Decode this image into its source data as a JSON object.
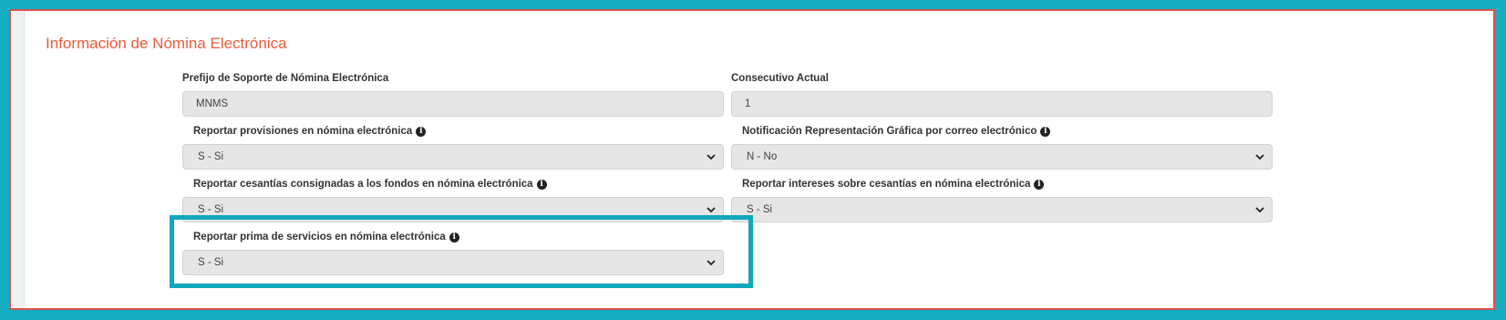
{
  "section": {
    "title": "Información de Nómina Electrónica"
  },
  "fields": {
    "prefijo": {
      "label": "Prefijo de Soporte de Nómina Electrónica",
      "value": "MNMS"
    },
    "consecutivo": {
      "label": "Consecutivo Actual",
      "value": "1"
    },
    "provisiones": {
      "label": "Reportar provisiones en nómina electrónica",
      "selected": "S - Si"
    },
    "notificacion": {
      "label": "Notificación Representación Gráfica por correo electrónico",
      "selected": "N - No"
    },
    "cesantias": {
      "label": "Reportar cesantías consignadas a los fondos en nómina electrónica",
      "selected": "S - Si"
    },
    "intereses": {
      "label": "Reportar intereses sobre cesantías en nómina electrónica",
      "selected": "S - Si"
    },
    "prima": {
      "label": "Reportar prima de servicios en nómina electrónica",
      "selected": "S - Si"
    }
  },
  "icons": {
    "info": "info-circle-icon",
    "dropdown": "chevron-down-icon"
  },
  "colors": {
    "background_frame": "#14adc0",
    "panel_border": "#d9534f",
    "title": "#ea5b3a",
    "highlight": "#13a7bb"
  }
}
